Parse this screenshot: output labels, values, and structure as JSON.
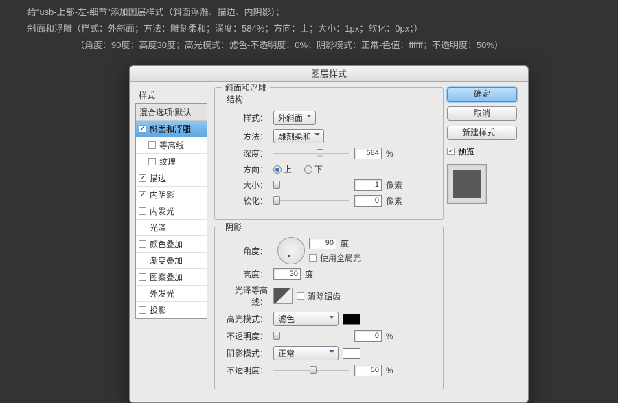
{
  "desc": {
    "line1": "给“usb-上部-左-细节”添加图层样式（斜面浮雕、描边、内阴影）；",
    "line2": "斜面和浮雕（样式：外斜面；方法：雕刻柔和；深度：584%；方向：上；大小：1px；软化：0px；）",
    "line3": "（角度：90度；高度30度；高光模式：滤色-不透明度：0%；阴影模式：正常-色值：ffffff；不透明度：50%）"
  },
  "dialog": {
    "title": "图层样式"
  },
  "sidebar": {
    "head": "样式",
    "sub": "混合选项:默认",
    "items": [
      {
        "label": "斜面和浮雕",
        "checked": true,
        "sel": true
      },
      {
        "label": "等高线",
        "checked": false,
        "sub": true
      },
      {
        "label": "纹理",
        "checked": false,
        "sub": true
      },
      {
        "label": "描边",
        "checked": true
      },
      {
        "label": "内阴影",
        "checked": true
      },
      {
        "label": "内发光",
        "checked": false
      },
      {
        "label": "光泽",
        "checked": false
      },
      {
        "label": "颜色叠加",
        "checked": false
      },
      {
        "label": "渐变叠加",
        "checked": false
      },
      {
        "label": "图案叠加",
        "checked": false
      },
      {
        "label": "外发光",
        "checked": false
      },
      {
        "label": "投影",
        "checked": false
      }
    ]
  },
  "panel": {
    "bevel": {
      "legend": "斜面和浮雕",
      "structure": "结构",
      "style_label": "样式：",
      "style_value": "外斜面",
      "technique_label": "方法：",
      "technique_value": "雕刻柔和",
      "depth_label": "深度：",
      "depth_value": "584",
      "depth_unit": "%",
      "dir_label": "方向：",
      "dir_up": "上",
      "dir_down": "下",
      "size_label": "大小：",
      "size_value": "1",
      "size_unit": "像素",
      "soften_label": "软化：",
      "soften_value": "0",
      "soften_unit": "像素"
    },
    "shading": {
      "legend": "阴影",
      "angle_label": "角度：",
      "angle_value": "90",
      "angle_unit": "度",
      "global_label": "使用全局光",
      "altitude_label": "高度：",
      "altitude_value": "30",
      "altitude_unit": "度",
      "gloss_label": "光泽等高线：",
      "antialias_label": "消除锯齿",
      "highlight_mode_label": "高光模式：",
      "highlight_mode_value": "滤色",
      "hl_opacity_label": "不透明度：",
      "hl_opacity_value": "0",
      "hl_opacity_unit": "%",
      "shadow_mode_label": "阴影模式：",
      "shadow_mode_value": "正常",
      "sh_opacity_label": "不透明度：",
      "sh_opacity_value": "50",
      "sh_opacity_unit": "%"
    }
  },
  "buttons": {
    "ok": "确定",
    "cancel": "取消",
    "newstyle": "新建样式...",
    "preview": "预览"
  }
}
